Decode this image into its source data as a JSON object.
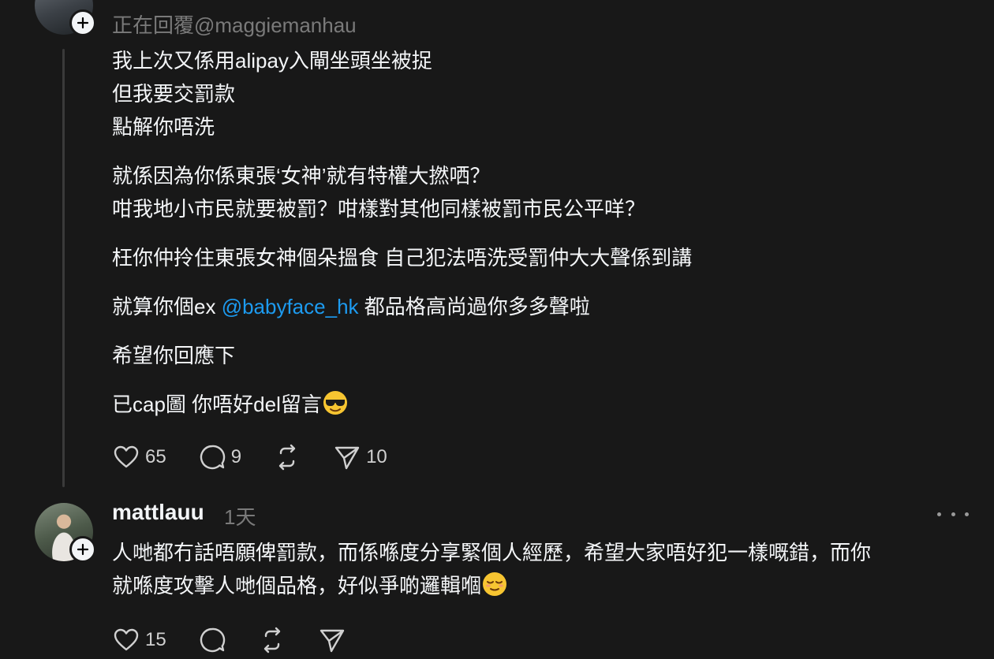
{
  "reply_header": {
    "replying_to": "正在回覆@maggiemanhau"
  },
  "post": {
    "lines": [
      "我上次又係用alipay入閘坐頭坐被捉",
      "但我要交罰款",
      "點解你唔洗",
      "就係因為你係東張‘女神’就有特權大撚哂？",
      "咁我地小市民就要被罰？咁樣對其他同樣被罰市民公平咩？",
      "枉你仲拎住東張女神個朵搵食 自己犯法唔洗受罰仲大大聲係到講",
      "就算你個ex ",
      "@babyface_hk",
      " 都品格高尚過你多多聲啦",
      "希望你回應下",
      "已cap圖 你唔好del留言"
    ],
    "emoji": "sunglasses-emoji",
    "likes": "65",
    "comments": "9",
    "shares": "10"
  },
  "reply": {
    "username": "mattlauu",
    "time": "1天",
    "line1": "人哋都冇話唔願俾罰款，而係喺度分享緊個人經歷，希望大家唔好犯一樣嘅錯，而你",
    "line2": "就喺度攻擊人哋個品格，好似爭啲邏輯嗰",
    "emoji": "relieved-emoji",
    "likes": "15"
  },
  "colors": {
    "background": "#181818",
    "text": "#f3f5f7",
    "muted": "#7a7a7a",
    "mention": "#1d9bf0"
  }
}
